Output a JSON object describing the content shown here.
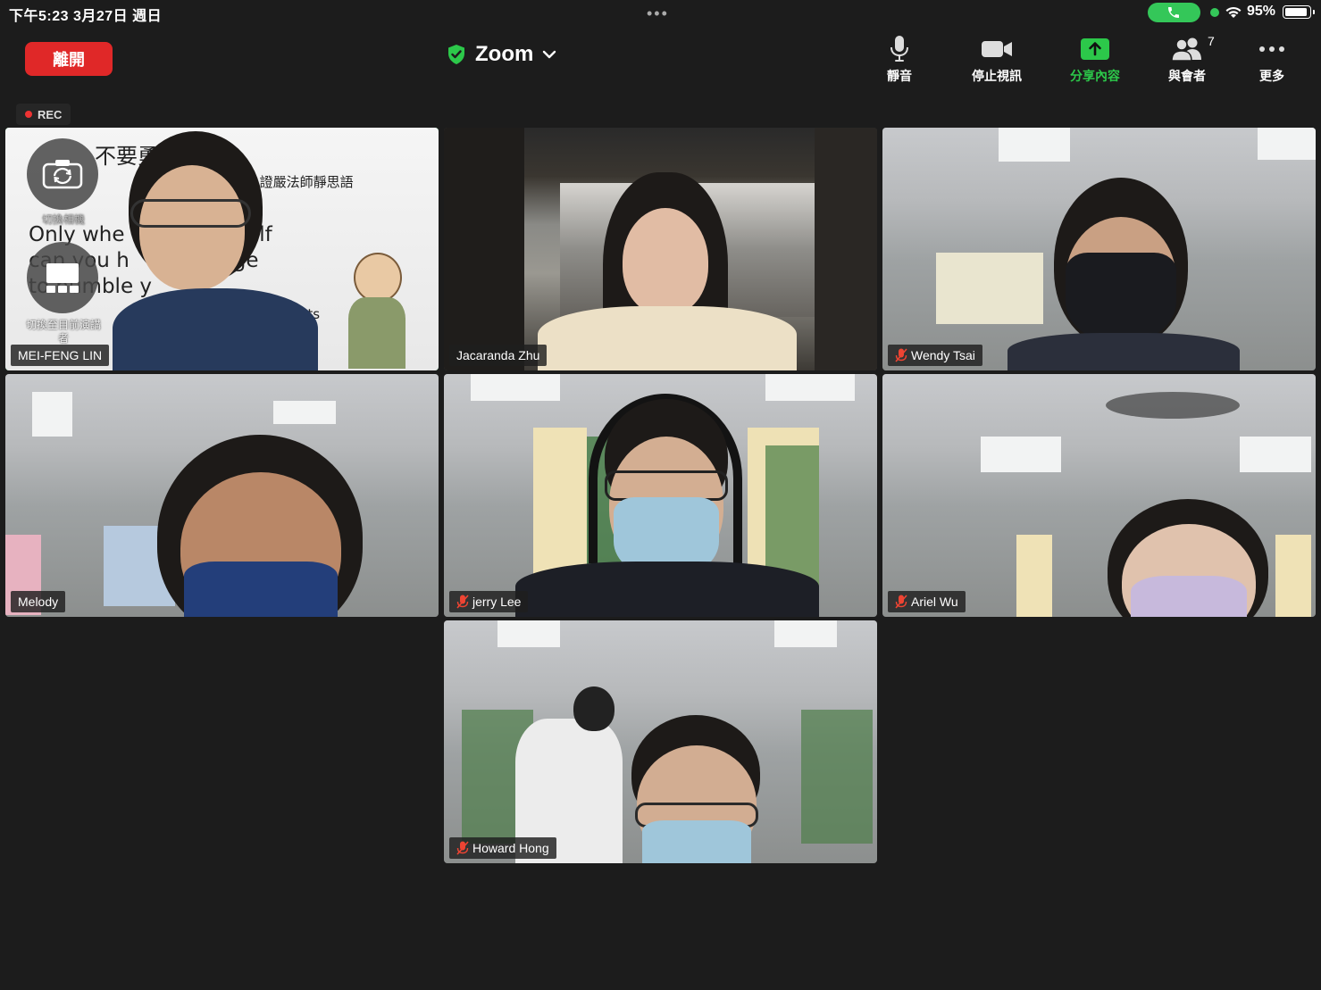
{
  "status_bar": {
    "time_date": "下午5:23   3月27日 週日",
    "more_dots": "•••",
    "battery_text": "95%",
    "colors": {
      "call_pill": "#34c759"
    }
  },
  "toolbar": {
    "leave_label": "離開",
    "app_title": "Zoom",
    "items": [
      {
        "label": "靜音",
        "icon": "microphone-icon"
      },
      {
        "label": "停止視訊",
        "icon": "video-camera-icon"
      },
      {
        "label": "分享內容",
        "icon": "share-screen-icon"
      },
      {
        "label": "與會者",
        "icon": "participants-icon"
      },
      {
        "label": "更多",
        "icon": "more-icon"
      }
    ],
    "participant_count": "7",
    "colors": {
      "leave": "#e02828",
      "share": "#2cc84a",
      "shield": "#2cc84a"
    }
  },
  "recording": {
    "label": "REC"
  },
  "self_controls": {
    "switch_camera_label": "切換相機",
    "switch_view_label": "切換至目前演講者"
  },
  "slide": {
    "line1_cn": "不要勇於自己。",
    "line2_cn": "~證嚴法師靜思語",
    "en_line1": "Only whe      ct yourself",
    "en_line2": "can you h       courage",
    "en_line3": "to humble y",
    "thoughts": "Thoughts"
  },
  "participants": [
    {
      "name": "MEI-FENG LIN",
      "muted": false,
      "active_speaker": true
    },
    {
      "name": "Jacaranda Zhu",
      "muted": false,
      "active_speaker": false
    },
    {
      "name": "Wendy Tsai",
      "muted": true,
      "active_speaker": false
    },
    {
      "name": "Melody",
      "muted": false,
      "active_speaker": false
    },
    {
      "name": "jerry Lee",
      "muted": true,
      "active_speaker": false
    },
    {
      "name": "Ariel Wu",
      "muted": true,
      "active_speaker": false
    },
    {
      "name": "Howard Hong",
      "muted": true,
      "active_speaker": false
    }
  ]
}
